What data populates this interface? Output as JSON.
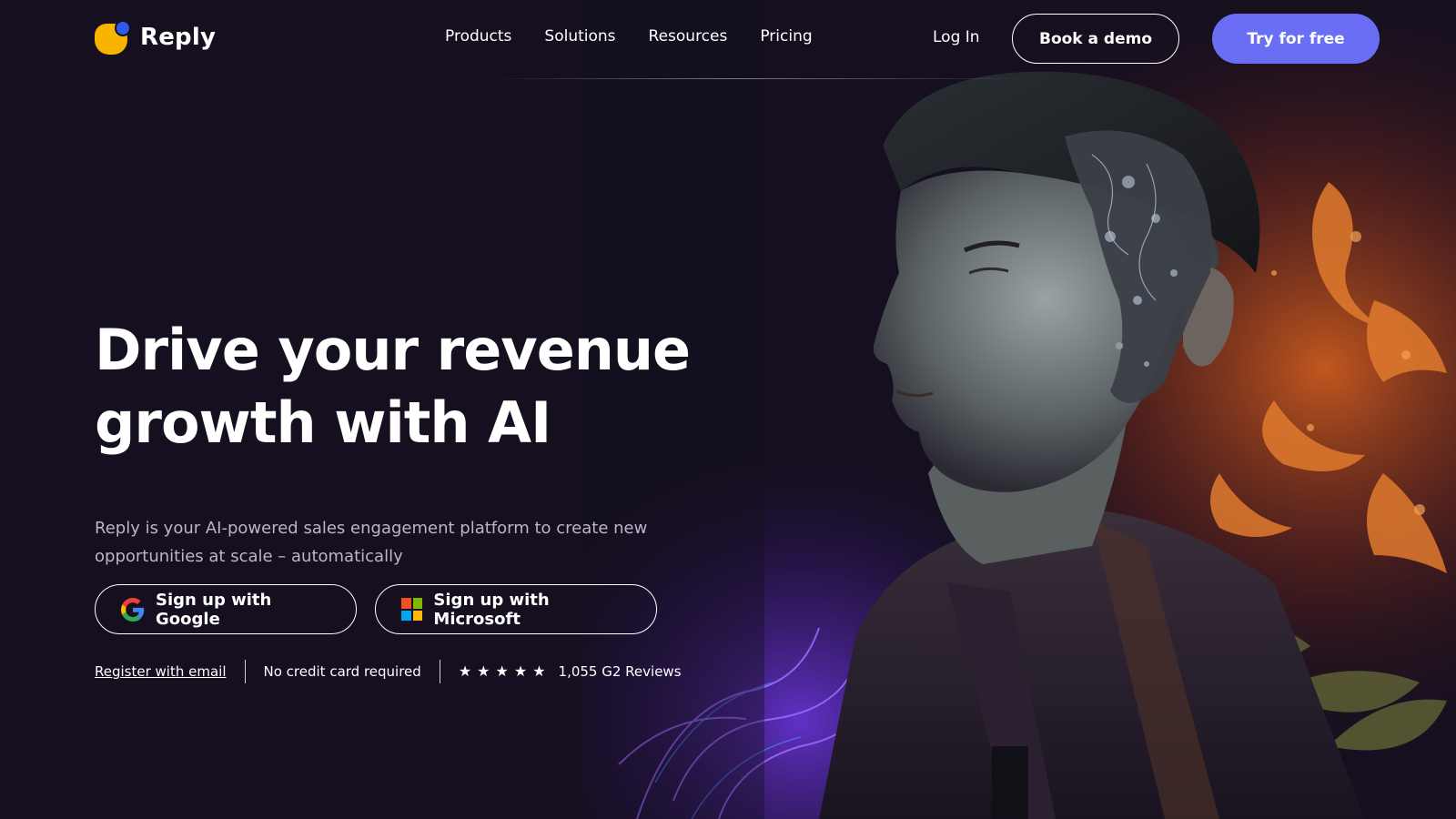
{
  "brand": {
    "name": "Reply",
    "logo_colors": {
      "blob": "#f7b500",
      "dot": "#2f5bea"
    }
  },
  "nav": {
    "items": [
      {
        "label": "Products"
      },
      {
        "label": "Solutions"
      },
      {
        "label": "Resources"
      },
      {
        "label": "Pricing"
      }
    ],
    "login": "Log In",
    "demo_button": "Book a demo",
    "try_button": "Try for free"
  },
  "hero": {
    "title_line1": "Drive your revenue",
    "title_line2": "growth with AI",
    "subtitle": "Reply is your AI-powered sales engagement platform to create new opportunities at scale – automatically",
    "google_button": "Sign up with Google",
    "microsoft_button": "Sign up with Microsoft",
    "register_link": "Register with email",
    "no_card": "No credit card required",
    "rating_stars": 5,
    "reviews": "1,055 G2 Reviews"
  },
  "colors": {
    "background": "#150f1f",
    "accent": "#6a6ef5",
    "subtitle_text": "#bdb5c8"
  },
  "icons": {
    "google": "google-g-icon",
    "microsoft": "microsoft-logo-icon",
    "star": "star-icon"
  }
}
